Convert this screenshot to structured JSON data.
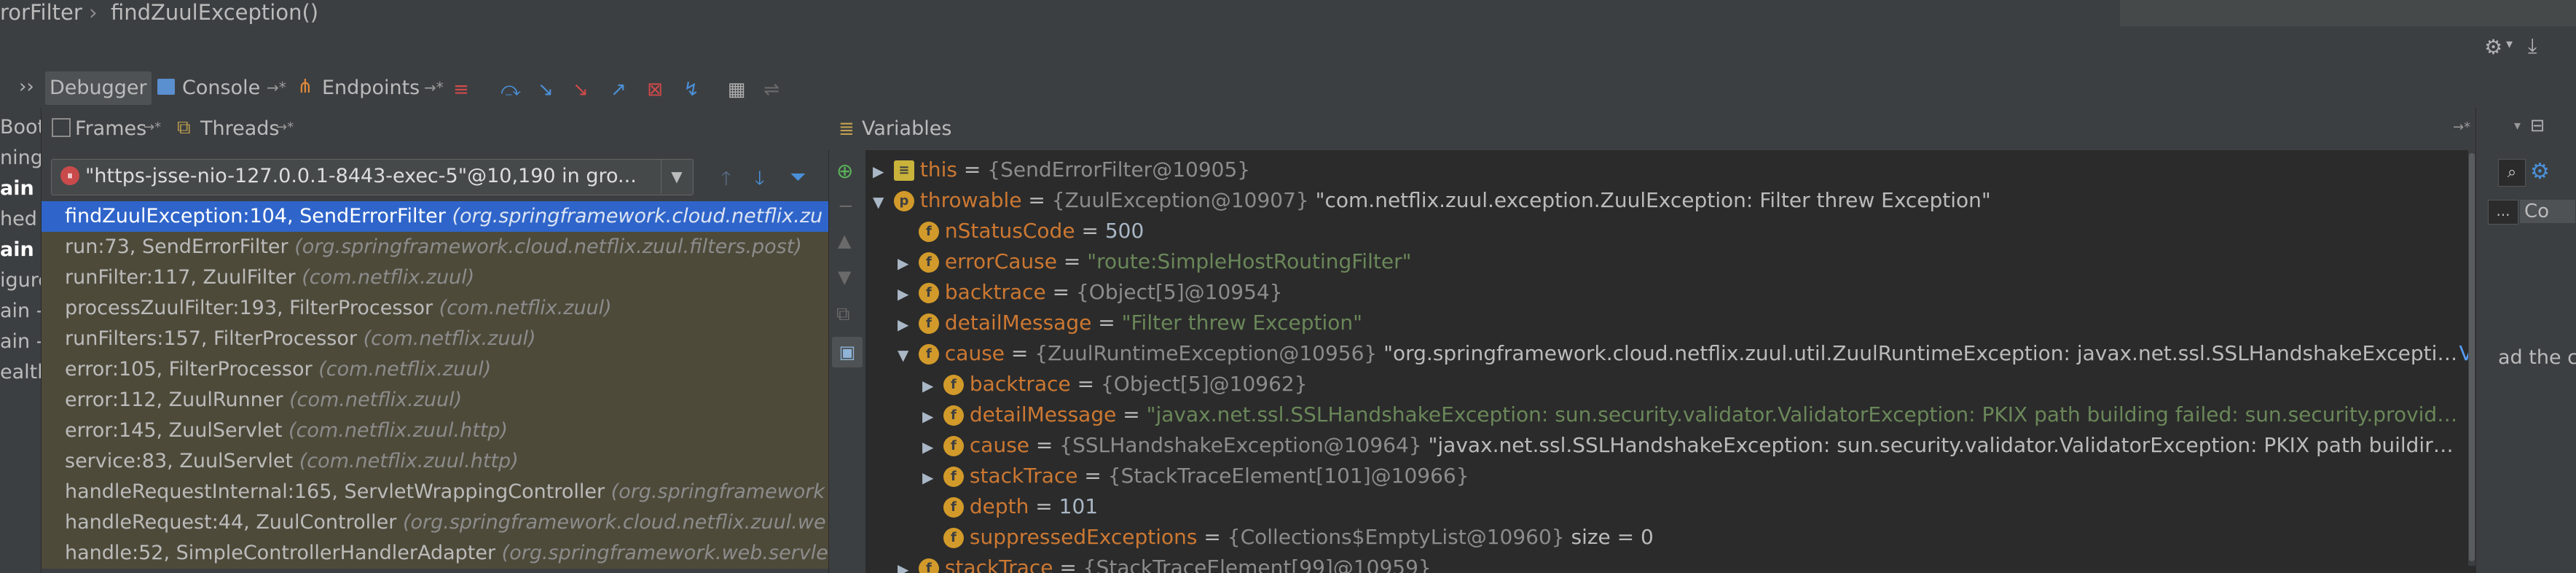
{
  "breadcrumb": {
    "items": [
      "rorFilter",
      "findZuulException()"
    ],
    "separator": "›"
  },
  "tabs": [
    {
      "label": "Debugger",
      "icon": "debugger-icon"
    },
    {
      "label": "Console",
      "icon": "console-icon"
    },
    {
      "label": "Endpoints",
      "icon": "endpoints-icon"
    }
  ],
  "frames_panel": {
    "frames_label": "Frames",
    "threads_label": "Threads",
    "thread_value": "\"https-jsse-nio-127.0.0.1-8443-exec-5\"@10,190 in gro..."
  },
  "gutter_lines": [
    {
      "text": "Boot",
      "bold": false
    },
    {
      "text": "ning",
      "bold": false
    },
    {
      "text": "ain",
      "bold": true
    },
    {
      "text": "hed",
      "bold": false
    },
    {
      "text": "ain",
      "bold": true
    },
    {
      "text": "igure",
      "bold": false
    },
    {
      "text": "ain -",
      "bold": false
    },
    {
      "text": "ain -",
      "bold": false
    },
    {
      "text": "ealth",
      "bold": false
    }
  ],
  "frames": [
    {
      "method": "findZuulException:104, SendErrorFilter",
      "pkg": "(org.springframework.cloud.netflix.zu",
      "selected": true
    },
    {
      "method": "run:73, SendErrorFilter",
      "pkg": "(org.springframework.cloud.netflix.zuul.filters.post)",
      "selected": false
    },
    {
      "method": "runFilter:117, ZuulFilter",
      "pkg": "(com.netflix.zuul)",
      "selected": false
    },
    {
      "method": "processZuulFilter:193, FilterProcessor",
      "pkg": "(com.netflix.zuul)",
      "selected": false
    },
    {
      "method": "runFilters:157, FilterProcessor",
      "pkg": "(com.netflix.zuul)",
      "selected": false
    },
    {
      "method": "error:105, FilterProcessor",
      "pkg": "(com.netflix.zuul)",
      "selected": false
    },
    {
      "method": "error:112, ZuulRunner",
      "pkg": "(com.netflix.zuul)",
      "selected": false
    },
    {
      "method": "error:145, ZuulServlet",
      "pkg": "(com.netflix.zuul.http)",
      "selected": false
    },
    {
      "method": "service:83, ZuulServlet",
      "pkg": "(com.netflix.zuul.http)",
      "selected": false
    },
    {
      "method": "handleRequestInternal:165, ServletWrappingController",
      "pkg": "(org.springframework",
      "selected": false
    },
    {
      "method": "handleRequest:44, ZuulController",
      "pkg": "(org.springframework.cloud.netflix.zuul.we",
      "selected": false
    },
    {
      "method": "handle:52, SimpleControllerHandlerAdapter",
      "pkg": "(org.springframework.web.servle",
      "selected": false
    }
  ],
  "variables_panel": {
    "title": "Variables",
    "view_label": "View",
    "rows": [
      {
        "indent": 0,
        "toggle": "▶",
        "icon": "≡",
        "name": "this",
        "eq": " = ",
        "type": "{SendErrorFilter@10905}",
        "value": "",
        "vclass": "",
        "view": false
      },
      {
        "indent": 0,
        "toggle": "▼",
        "icon": "p",
        "name": "throwable",
        "eq": " = ",
        "type": "{ZuulException@10907}",
        "value": " \"com.netflix.zuul.exception.ZuulException: Filter threw Exception\"",
        "vclass": "txt",
        "view": false
      },
      {
        "indent": 1,
        "toggle": "",
        "icon": "f",
        "name": "nStatusCode",
        "eq": " = ",
        "type": "",
        "value": "500",
        "vclass": "num",
        "view": false
      },
      {
        "indent": 1,
        "toggle": "▶",
        "icon": "f",
        "name": "errorCause",
        "eq": " = ",
        "type": "",
        "value": "\"route:SimpleHostRoutingFilter\"",
        "vclass": "str",
        "view": false
      },
      {
        "indent": 1,
        "toggle": "▶",
        "icon": "f",
        "name": "backtrace",
        "eq": " = ",
        "type": "{Object[5]@10954}",
        "value": "",
        "vclass": "",
        "view": false
      },
      {
        "indent": 1,
        "toggle": "▶",
        "icon": "f",
        "name": "detailMessage",
        "eq": " = ",
        "type": "",
        "value": "\"Filter threw Exception\"",
        "vclass": "str",
        "view": false
      },
      {
        "indent": 1,
        "toggle": "▼",
        "icon": "f",
        "name": "cause",
        "eq": " = ",
        "type": "{ZuulRuntimeException@10956}",
        "value": " \"org.springframework.cloud.netflix.zuul.util.ZuulRuntimeException: javax.net.ssl.SSLHandshakeExcepti…",
        "vclass": "txt",
        "view": true
      },
      {
        "indent": 2,
        "toggle": "▶",
        "icon": "f",
        "name": "backtrace",
        "eq": " = ",
        "type": "{Object[5]@10962}",
        "value": "",
        "vclass": "",
        "view": false
      },
      {
        "indent": 2,
        "toggle": "▶",
        "icon": "f",
        "name": "detailMessage",
        "eq": " = ",
        "type": "",
        "value": "\"javax.net.ssl.SSLHandshakeException: sun.security.validator.ValidatorException: PKIX path building failed: sun.security.provid…",
        "vclass": "str",
        "view": true
      },
      {
        "indent": 2,
        "toggle": "▶",
        "icon": "f",
        "name": "cause",
        "eq": " = ",
        "type": "{SSLHandshakeException@10964}",
        "value": " \"javax.net.ssl.SSLHandshakeException: sun.security.validator.ValidatorException: PKIX path buildir…",
        "vclass": "txt",
        "view": true
      },
      {
        "indent": 2,
        "toggle": "▶",
        "icon": "f",
        "name": "stackTrace",
        "eq": " = ",
        "type": "{StackTraceElement[101]@10966}",
        "value": "",
        "vclass": "",
        "view": false
      },
      {
        "indent": 2,
        "toggle": "",
        "icon": "f",
        "name": "depth",
        "eq": " = ",
        "type": "",
        "value": "101",
        "vclass": "num",
        "view": false
      },
      {
        "indent": 2,
        "toggle": "",
        "icon": "f",
        "name": "suppressedExceptions",
        "eq": " = ",
        "type": "{Collections$EmptyList@10960}",
        "value": "  size = 0",
        "vclass": "txt",
        "view": false
      },
      {
        "indent": 1,
        "toggle": "▶",
        "icon": "f",
        "name": "stackTrace",
        "eq": " = ",
        "type": "{StackTraceElement[99]@10959}",
        "value": "",
        "vclass": "",
        "view": false
      }
    ]
  },
  "right_side": {
    "clipped_text": "ad the c",
    "button_label": "...",
    "column_label": "Co"
  },
  "colors": {
    "selection": "#2f65ca",
    "frame_bg": "#4e4a3a",
    "field_name": "#cc7832",
    "string": "#6a8759",
    "view_link": "#589df6"
  }
}
